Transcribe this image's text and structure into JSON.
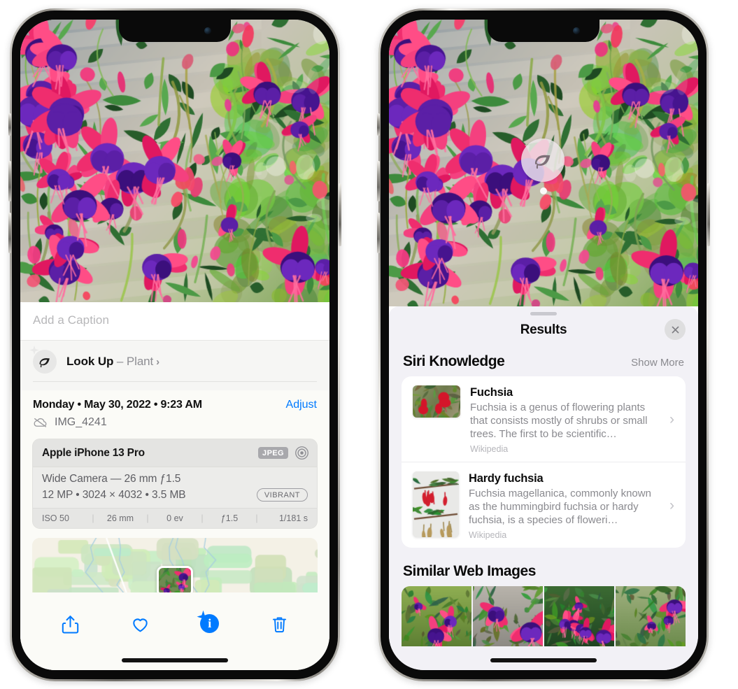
{
  "left_phone": {
    "photo_alt": "fuchsia-plant-photo",
    "caption_field": {
      "placeholder": "Add a Caption",
      "value": ""
    },
    "look_up": {
      "label": "Look Up",
      "separator": " – ",
      "subject": "Plant",
      "chevron": "›",
      "icon": "leaf-icon"
    },
    "meta": {
      "date": "Monday • May 30, 2022 • 9:23 AM",
      "adjust_label": "Adjust",
      "filename": "IMG_4241",
      "cloud_icon": "icloud-slash-icon"
    },
    "exif": {
      "device": "Apple iPhone 13 Pro",
      "format_badge": "JPEG",
      "lens_icon": "aperture-icon",
      "lens_line": "Wide Camera — 26 mm ƒ1.5",
      "specs_line": "12 MP • 3024 × 4032 • 3.5 MB",
      "style_badge": "VIBRANT",
      "settings": [
        "ISO 50",
        "26 mm",
        "0 ev",
        "ƒ1.5",
        "1/181 s"
      ]
    },
    "map": {
      "pin_label": "photo-location-pin"
    },
    "toolbar": [
      {
        "name": "share-button",
        "icon": "share-icon"
      },
      {
        "name": "favorite-button",
        "icon": "heart-icon"
      },
      {
        "name": "info-button",
        "icon": "info-circle-sparkle-icon"
      },
      {
        "name": "delete-button",
        "icon": "trash-icon"
      }
    ]
  },
  "right_phone": {
    "photo_alt": "fuchsia-plant-photo",
    "visual_lookup_badge": {
      "icon": "leaf-icon"
    },
    "sheet": {
      "title": "Results",
      "close_label": "Close",
      "sections": [
        {
          "title": "Siri Knowledge",
          "action": "Show More",
          "items": [
            {
              "title": "Fuchsia",
              "description": "Fuchsia is a genus of flowering plants that consists mostly of shrubs or small trees. The first to be scientific…",
              "source": "Wikipedia",
              "thumb": "fuchsia-red-flowers-thumb",
              "chevron": "›"
            },
            {
              "title": "Hardy fuchsia",
              "description": "Fuchsia magellanica, commonly known as the hummingbird fuchsia or hardy fuchsia, is a species of floweri…",
              "source": "Wikipedia",
              "thumb": "hardy-fuchsia-specimen-thumb",
              "chevron": "›"
            }
          ]
        },
        {
          "title": "Similar Web Images",
          "images": [
            "fuchsia-pink-white-bloom",
            "fuchsia-red-closeup",
            "fuchsia-bush-buds",
            "fuchsia-purple-magenta"
          ]
        }
      ]
    }
  },
  "colors": {
    "accent_blue": "#007aff",
    "sheet_bg": "#f2f1f6",
    "card_bg": "#ffffff",
    "secondary_text": "#8a8a8f",
    "tertiary_text": "#b5b5ba",
    "exif_bg": "#ececea",
    "badge_gray": "#a8a8ac"
  }
}
